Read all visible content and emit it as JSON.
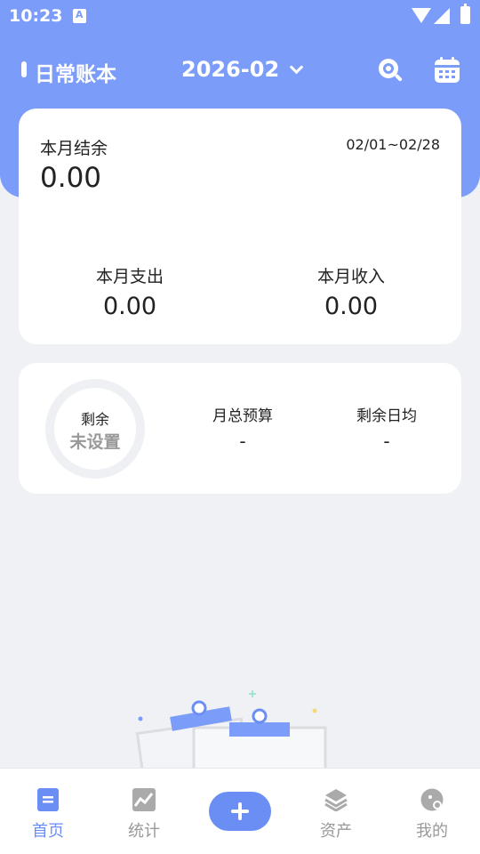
{
  "status_bar": {
    "time": "10:23"
  },
  "header": {
    "book_name": "日常账本",
    "month": "2026-02"
  },
  "summary": {
    "balance_label": "本月结余",
    "balance_value": "0.00",
    "date_range": "02/01~02/28",
    "expense_label": "本月支出",
    "expense_value": "0.00",
    "income_label": "本月收入",
    "income_value": "0.00"
  },
  "budget": {
    "ring_label": "剩余",
    "ring_value": "未设置",
    "total_label": "月总预算",
    "total_value": "-",
    "daily_label": "剩余日均",
    "daily_value": "-"
  },
  "nav": {
    "items": [
      {
        "label": "首页",
        "icon": "home-icon",
        "active": true
      },
      {
        "label": "统计",
        "icon": "stats-icon",
        "active": false
      },
      {
        "label": "资产",
        "icon": "assets-icon",
        "active": false
      },
      {
        "label": "我的",
        "icon": "profile-icon",
        "active": false
      }
    ]
  },
  "colors": {
    "primary": "#7b9cf9",
    "accent": "#6b8ef5",
    "background": "#f0f1f5",
    "muted": "#999999"
  }
}
